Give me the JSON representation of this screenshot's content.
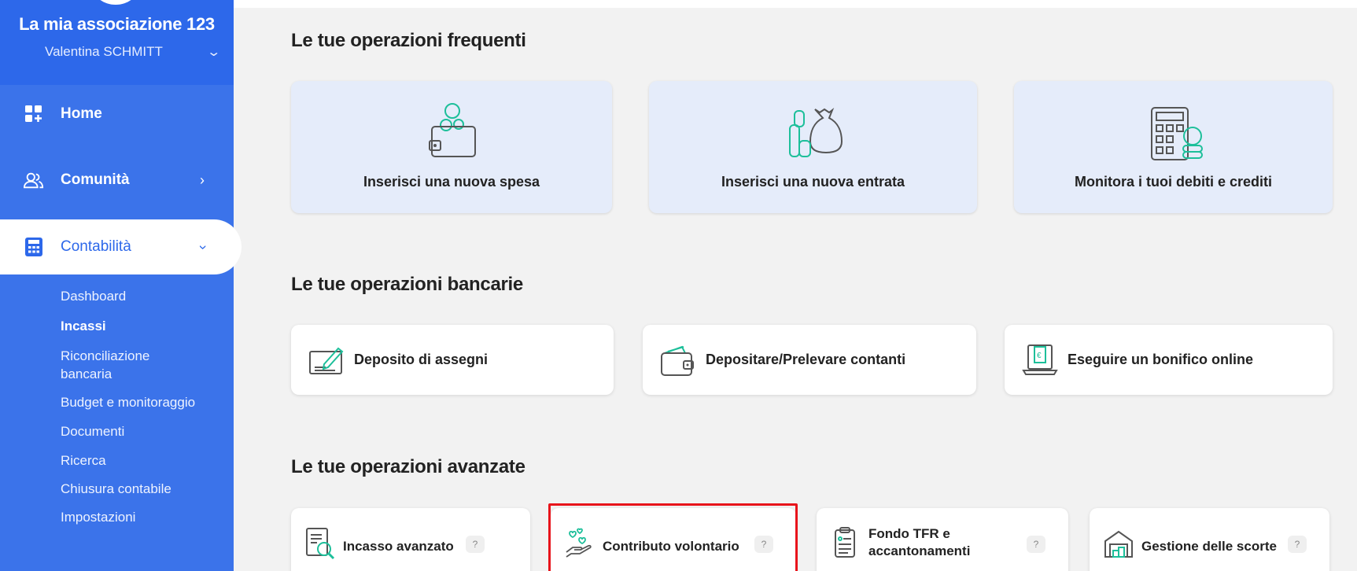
{
  "sidebar": {
    "org_name": "La mia associazione 123",
    "user_name": "Valentina SCHMITT",
    "nav": {
      "home": "Home",
      "community": "Comunità",
      "accounting": "Contabilità"
    },
    "sub_items": [
      "Dashboard",
      "Incassi",
      "Riconciliazione bancaria",
      "Budget e monitoraggio",
      "Documenti",
      "Ricerca",
      "Chiusura contabile",
      "Impostazioni"
    ],
    "current_sub_item": "Incassi",
    "colors": {
      "sidebar": "#3b73ea",
      "active_text": "#2d68ea"
    }
  },
  "main": {
    "frequent": {
      "title": "Le tue operazioni frequenti",
      "cards": [
        {
          "label": "Inserisci una nuova spesa",
          "icon": "wallet-coins-icon"
        },
        {
          "label": "Inserisci una nuova entrata",
          "icon": "money-bag-icon"
        },
        {
          "label": "Monitora i tuoi debiti e crediti",
          "icon": "calculator-coins-icon"
        }
      ]
    },
    "banking": {
      "title": "Le tue operazioni bancarie",
      "cards": [
        {
          "label": "Deposito di assegni",
          "icon": "check-pen-icon"
        },
        {
          "label": "Depositare/Prelevare contanti",
          "icon": "cash-wallet-icon"
        },
        {
          "label": "Eseguire un bonifico online",
          "icon": "laptop-transfer-icon"
        }
      ]
    },
    "advanced": {
      "title": "Le tue operazioni avanzate",
      "cards": [
        {
          "label": "Incasso avanzato",
          "icon": "document-search-icon",
          "help": "?"
        },
        {
          "label": "Contributo volontario",
          "icon": "hand-hearts-icon",
          "help": "?"
        },
        {
          "label": "Fondo TFR e accantonamenti",
          "label_line1": "Fondo TFR e",
          "label_line2": "accantonamenti",
          "icon": "document-list-icon",
          "help": "?"
        },
        {
          "label": "Gestione delle scorte",
          "icon": "warehouse-icon",
          "help": "?"
        }
      ],
      "highlighted_card": "Contributo volontario"
    }
  }
}
